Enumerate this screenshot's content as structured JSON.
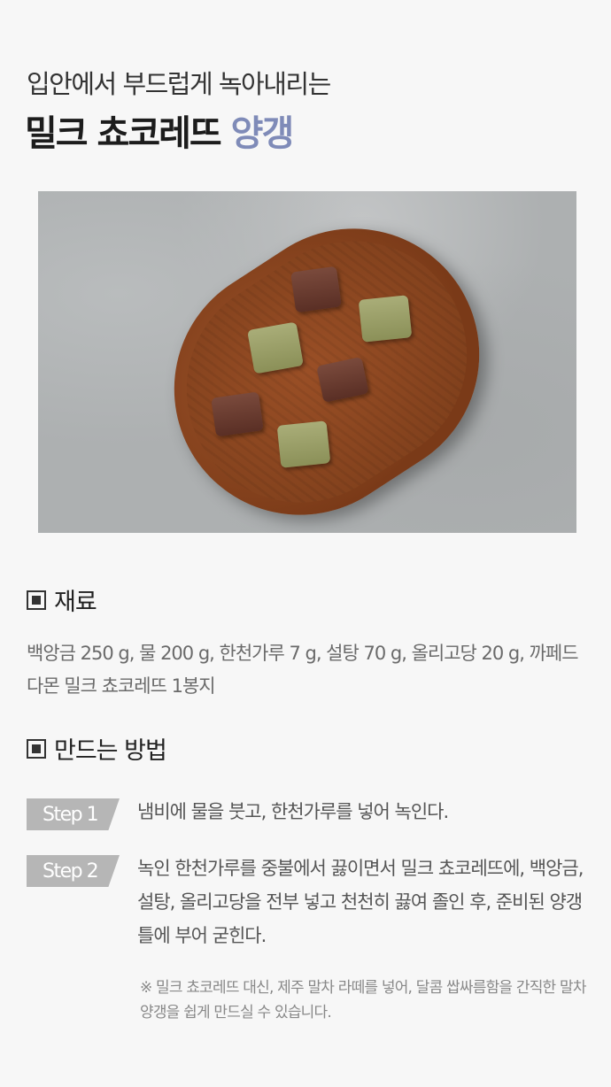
{
  "header": {
    "subtitle": "입안에서 부드럽게 녹아내리는",
    "title_main": "밀크 쵸코레뜨",
    "title_accent": "양갱"
  },
  "sections": {
    "ingredients_title": "재료",
    "ingredients_text": "백앙금 250 g, 물 200 g, 한천가루 7 g, 설탕 70 g, 올리고당 20 g, 까페드다몬 밀크 쵸코레뜨 1봉지",
    "method_title": "만드는 방법"
  },
  "steps": [
    {
      "label": "Step 1",
      "text": "냄비에 물을 붓고, 한천가루를 넣어 녹인다."
    },
    {
      "label": "Step 2",
      "text": "녹인 한천가루를 중불에서 끓이면서 밀크 쵸코레뜨에, 백앙금, 설탕, 올리고당을 전부 넣고 천천히 끓여 졸인 후, 준비된 양갱 틀에 부어 굳힌다."
    }
  ],
  "note": "※ 밀크 쵸코레뜨 대신, 제주 말차 라떼를 넣어, 달콤 쌉싸름함을 간직한 말차 양갱을 쉽게 만드실 수 있습니다.",
  "colors": {
    "accent": "#7f8bb8",
    "badge": "#b6b6b6"
  }
}
